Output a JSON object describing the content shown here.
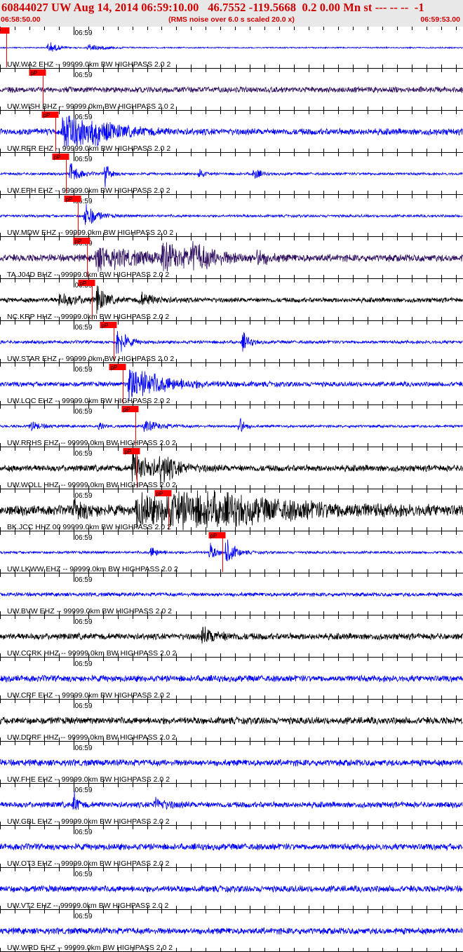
{
  "header": {
    "title": "60844027 UW Aug 14, 2014 06:59:10.00   46.7552 -119.5668  0.2 0.00 Mn st --- -- --  -1",
    "time_start": "06:58:50.00",
    "rms_note": "(RMS noise over 6.0 s scaled 20.0 x)",
    "time_end": "06:59:53.00"
  },
  "chart_data": {
    "type": "line",
    "title": "60844027 UW Aug 14, 2014 06:59:10.00   46.7552 -119.5668  0.2 0.00 Mn st --- -- --  -1",
    "subtitle": "(RMS noise over 6.0 s scaled 20.0 x)",
    "x_range": [
      "06:58:50.00",
      "06:59:53.00"
    ],
    "x_tick_label": "06:59",
    "x_tick_minute_s": 10,
    "tick_interval_s": 2,
    "time_span_s": 63,
    "grid": true,
    "pick_label": "pP",
    "colors": {
      "blue": "#0000ff",
      "purple": "#301060",
      "black": "#000000",
      "pick": "#ff0000"
    },
    "traces": [
      {
        "label": "UW.WA2 EHZ -- 99999.0km BW  HIGHPASS  2.0  2",
        "color": "#0000ff",
        "pick_s": 0.9,
        "noise": 0.04,
        "events": [
          [
            6.5,
            0.4,
            1.2
          ],
          [
            11.8,
            0.25,
            2.0
          ]
        ]
      },
      {
        "label": "UW.WISH BHZ -- 99999.0km BW  HIGHPASS  2.0  2",
        "color": "#301060",
        "pick_s": 5.8,
        "noise": 0.18,
        "events": []
      },
      {
        "label": "UW.RER EHZ -- 99999.0km BW  HIGHPASS  2.0  2",
        "color": "#0000ff",
        "pick_s": 7.5,
        "noise": 0.2,
        "events": [
          [
            8.5,
            1.6,
            3.0
          ],
          [
            12.5,
            0.4,
            4.0
          ]
        ]
      },
      {
        "label": "UW.EPH EHZ -- 99999.0km BW  HIGHPASS  2.0  2",
        "color": "#0000ff",
        "pick_s": 9.0,
        "noise": 0.08,
        "events": [
          [
            9.5,
            0.8,
            1.0
          ],
          [
            14.3,
            0.8,
            0.6
          ],
          [
            27.0,
            0.5,
            0.5
          ],
          [
            34.5,
            0.6,
            0.6
          ]
        ]
      },
      {
        "label": "UW.MDW EHZ -- 99999.0km BW  HIGHPASS  2.0  2",
        "color": "#0000ff",
        "pick_s": 10.6,
        "noise": 0.08,
        "events": [
          [
            11.5,
            1.0,
            1.2
          ]
        ]
      },
      {
        "label": "TA.J04D BHZ -- 99999.0km BW  HIGHPASS  2.0  2",
        "color": "#301060",
        "pick_s": 11.8,
        "noise": 0.22,
        "events": [
          [
            13.0,
            0.7,
            6.0
          ],
          [
            22.0,
            0.8,
            3.0
          ],
          [
            26.0,
            0.7,
            3.0
          ],
          [
            35.0,
            0.5,
            1.0
          ]
        ]
      },
      {
        "label": "NC.KRP HHZ -- 99999.0km BW  HIGHPASS  2.0  2",
        "color": "#000000",
        "pick_s": 12.5,
        "noise": 0.15,
        "events": [
          [
            8.0,
            0.35,
            3.0
          ],
          [
            13.2,
            0.9,
            1.0
          ],
          [
            19.0,
            0.4,
            2.0
          ]
        ]
      },
      {
        "label": "UW.STAR EHZ -- 99999.0km BW  HIGHPASS  2.0  2",
        "color": "#0000ff",
        "pick_s": 15.5,
        "noise": 0.1,
        "events": [
          [
            15.9,
            1.2,
            1.0
          ],
          [
            33.0,
            0.6,
            0.8
          ]
        ]
      },
      {
        "label": "UW.LOC EHZ -- 99999.0km BW  HIGHPASS  2.0  2",
        "color": "#0000ff",
        "pick_s": 16.7,
        "noise": 0.15,
        "events": [
          [
            17.5,
            1.2,
            4.0
          ]
        ]
      },
      {
        "label": "UW.RRHS EHZ -- 99999.0km BW  HIGHPASS  2.0  2",
        "color": "#0000ff",
        "pick_s": 18.4,
        "noise": 0.08,
        "events": [
          [
            4.0,
            0.3,
            1.5
          ],
          [
            19.5,
            0.4,
            2.0
          ],
          [
            32.5,
            1.0,
            0.5
          ],
          [
            13.5,
            0.5,
            0.3
          ]
        ]
      },
      {
        "label": "UW.WOLL HHZ -- 99999.0km BW  HIGHPASS  2.0  2",
        "color": "#000000",
        "pick_s": 18.6,
        "noise": 0.2,
        "events": [
          [
            18.0,
            1.0,
            3.0
          ],
          [
            21.8,
            0.9,
            1.5
          ]
        ]
      },
      {
        "label": "BK.JCC HHZ 00 99999.0km BW  HIGHPASS  2.0  2",
        "color": "#000000",
        "pick_s": 22.9,
        "noise": 0.3,
        "events": [
          [
            10.0,
            0.6,
            2.0
          ],
          [
            18.5,
            1.3,
            3.0
          ],
          [
            22.0,
            1.6,
            12.0
          ]
        ]
      },
      {
        "label": "UW.LKWW EHZ -- 99999.0km BW  HIGHPASS  2.0  2",
        "color": "#0000ff",
        "pick_s": 30.3,
        "noise": 0.08,
        "events": [
          [
            20.5,
            0.35,
            1.0
          ],
          [
            28.5,
            0.6,
            0.8
          ],
          [
            30.7,
            1.0,
            1.0
          ]
        ]
      },
      {
        "label": "UW.BVW EHZ -- 99999.0km BW  HIGHPASS  2.0  2",
        "color": "#0000ff",
        "pick_s": null,
        "noise": 0.12,
        "events": []
      },
      {
        "label": "UW.CCRK HHZ -- 99999.0km BW  HIGHPASS  2.0  2",
        "color": "#000000",
        "pick_s": null,
        "noise": 0.2,
        "events": [
          [
            27.5,
            0.5,
            2.0
          ]
        ]
      },
      {
        "label": "UW.CRF EHZ -- 99999.0km BW  HIGHPASS  2.0  2",
        "color": "#0000ff",
        "pick_s": null,
        "noise": 0.2,
        "events": []
      },
      {
        "label": "UW.DDRF HHZ -- 99999.0km BW  HIGHPASS  2.0  2",
        "color": "#000000",
        "pick_s": null,
        "noise": 0.22,
        "events": []
      },
      {
        "label": "UW.FHE EHZ -- 99999.0km BW  HIGHPASS  2.0  2",
        "color": "#0000ff",
        "pick_s": null,
        "noise": 0.2,
        "events": []
      },
      {
        "label": "UW.GBL EHZ -- 99999.0km BW  HIGHPASS  2.0  2",
        "color": "#0000ff",
        "pick_s": null,
        "noise": 0.18,
        "events": [
          [
            10.0,
            0.8,
            0.5
          ],
          [
            21.0,
            0.4,
            1.5
          ]
        ]
      },
      {
        "label": "UW.OT3 EHZ -- 99999.0km BW  HIGHPASS  2.0  2",
        "color": "#0000ff",
        "pick_s": null,
        "noise": 0.2,
        "events": []
      },
      {
        "label": "UW.VT2 EHZ -- 99999.0km BW  HIGHPASS  2.0  2",
        "color": "#0000ff",
        "pick_s": null,
        "noise": 0.2,
        "events": []
      },
      {
        "label": "UW.WRD EHZ -- 99999.0km BW  HIGHPASS  2.0  2",
        "color": "#0000ff",
        "pick_s": null,
        "noise": 0.2,
        "events": []
      }
    ]
  }
}
